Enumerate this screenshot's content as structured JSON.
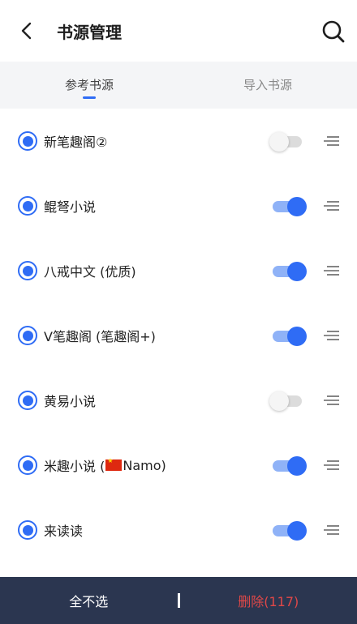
{
  "header": {
    "title": "书源管理"
  },
  "tabs": [
    {
      "label": "参考书源",
      "active": true
    },
    {
      "label": "导入书源",
      "active": false
    }
  ],
  "sources": [
    {
      "pre": "新笔趣阁②",
      "flag": false,
      "post": "",
      "enabled": false
    },
    {
      "pre": "鲲弩小说",
      "flag": false,
      "post": "",
      "enabled": true
    },
    {
      "pre": "八戒中文 (优质)",
      "flag": false,
      "post": "",
      "enabled": true
    },
    {
      "pre": "V笔趣阁 (笔趣阁+)",
      "flag": false,
      "post": "",
      "enabled": true
    },
    {
      "pre": "黄易小说",
      "flag": false,
      "post": "",
      "enabled": false
    },
    {
      "pre": "米趣小说 (",
      "flag": true,
      "post": "Namo)",
      "enabled": true
    },
    {
      "pre": "来读读",
      "flag": false,
      "post": "",
      "enabled": true
    }
  ],
  "footer": {
    "select_none": "全不选",
    "delete": "删除(117)"
  },
  "colors": {
    "accent": "#2f6cf5",
    "footer_bg": "#2b3650",
    "delete": "#e04848"
  }
}
